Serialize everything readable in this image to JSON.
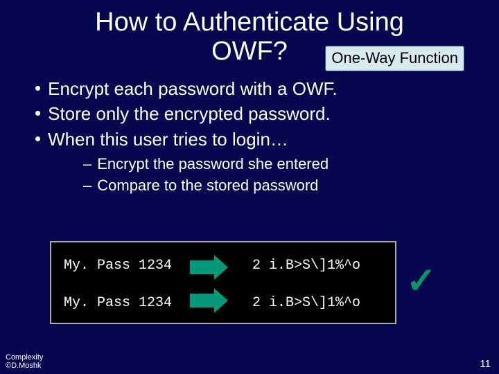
{
  "title": {
    "line1": "How to Authenticate Using",
    "line2": "OWF?"
  },
  "callout": "One-Way Function",
  "bullets": [
    "Encrypt each password with a OWF.",
    "Store only the encrypted password.",
    "When this user tries to login…"
  ],
  "sub_bullets": [
    "Encrypt the password she entered",
    "Compare to the stored password"
  ],
  "diagram": {
    "input1": "My. Pass 1234",
    "output1": "2 i.B>S\\]1%^o",
    "input2": "My. Pass 1234",
    "output2": "2 i.B>S\\]1%^o",
    "check": "✓"
  },
  "footer": {
    "line1": "Complexity",
    "line2": "©D.Moshk"
  },
  "page_number": "11"
}
